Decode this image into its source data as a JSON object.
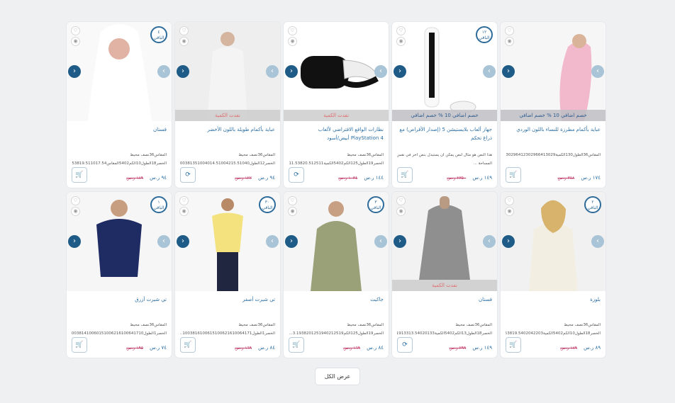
{
  "products": [
    {
      "title": "عباية بأكمام مطرزة للنساء باللون الوردي",
      "line1": "المقاس36الطول130الكمية30296412302966413029",
      "line2": "",
      "price": "١٧٤ ر.س",
      "old_price": "٣٤٨ ر.س",
      "banner": "خصم اضافي 10 % خصم اضافي",
      "banner_type": "discount",
      "badge": "",
      "cart": "cart-icon",
      "color": "#f0b8c8"
    },
    {
      "title": "جهاز ألعاب بلايستيشن 5 (إصدار الأقراص) مع ذراع تحكم",
      "line1": "هذا النص هو مثال لنص يمكن أن يستبدل بنص آخر في نفس",
      "line2": "المساحة ...",
      "price": "١٤٩ ر.س",
      "old_price": "٢٣٥٠ ر.س",
      "banner": "خصم اضافي 10 % خصم اضافي",
      "banner_type": "discount",
      "badge": "١٢ الباقي",
      "cart": "cart-icon",
      "color": "#ffffff"
    },
    {
      "title": "نظارات الواقع الافتراضي لألعاب PlayStation 4 أبيض/أسود",
      "line1": "المقاس36نصف محيط",
      "line2": "الخصر19الطول125الكم5402الكمية11.53820.512511...",
      "price": "١٤٤ ر.س",
      "old_price": "١٠٣٤ ر.س",
      "banner": "نفدت الكمية",
      "banner_type": "soldout",
      "badge": "",
      "cart": "refresh-icon",
      "color": "#ffffff"
    },
    {
      "title": "عباية بأكمام طويلة باللون الأخضر",
      "line1": "المقاس36نصف محيط",
      "line2": "الخصر12الطول100381351004014.51004215.51040...",
      "price": "٩٤ ر.س",
      "old_price": "١٢٢ ر.س",
      "banner": "نفدت الكمية",
      "banner_type": "soldout",
      "badge": "",
      "cart": "refresh-icon",
      "color": "#ececec"
    },
    {
      "title": "فستان",
      "line1": "المقاس36نصف محيط",
      "line2": "الخصر18الطول10الكم5402المقاس17.53819.511017.54...",
      "price": "٩٤ ر.س",
      "old_price": "١٨٩ ر.س",
      "banner": "",
      "banner_type": "",
      "badge": "٤ الباقي",
      "cart": "cart-icon",
      "color": "#ececec"
    },
    {
      "title": "بلوزة",
      "line1": "المقاس36نصف محيط",
      "line2": "الخصر18الطول10الكم5402الكمية19.53819.5402042203...",
      "price": "٨٩ ر.س",
      "old_price": "١٧٩ ر.س",
      "banner": "",
      "banner_type": "",
      "badge": "٢ الباقي",
      "cart": "cart-icon",
      "color": "#ececec"
    },
    {
      "title": "فستان",
      "line1": "المقاس36نصف محيط",
      "line2": "الخصر18الطول13الكم5402الكمية13.5381913313.54020133...",
      "price": "١٤٩ ر.س",
      "old_price": "٢٩٩ ر.س",
      "banner": "نفدت الكمية",
      "banner_type": "soldout",
      "badge": "",
      "cart": "refresh-icon",
      "color": "#ececec"
    },
    {
      "title": "جاكيت",
      "line1": "المقاس36نصف محيط",
      "line2": "الخصر19الطول125الكم3.1938201251940212519...",
      "price": "٨٤ ر.س",
      "old_price": "١٦٩ ر.س",
      "banner": "",
      "banner_type": "",
      "badge": "٣ الباقي",
      "cart": "cart-icon",
      "color": "#ececec"
    },
    {
      "title": "تي شيرت أصفر",
      "line1": "المقاس36نصف محيط",
      "line2": "الخصر1الطول1003816100615100621610064171...",
      "price": "٨٤ ر.س",
      "old_price": "١٦٩ ر.س",
      "banner": "",
      "banner_type": "",
      "badge": "٣٠ الباقي",
      "cart": "cart-icon",
      "color": "#ececec"
    },
    {
      "title": "تي شيرت أزرق",
      "line1": "المقاس36نصف محيط",
      "line2": "الخصر1الطول100381410060151006216100641710...",
      "price": "٧٤ ر.س",
      "old_price": "١٩٥ ر.س",
      "banner": "",
      "banner_type": "",
      "badge": "١ الباقي",
      "cart": "cart-icon",
      "color": "#ececec"
    }
  ],
  "view_all": "عرض الكل"
}
